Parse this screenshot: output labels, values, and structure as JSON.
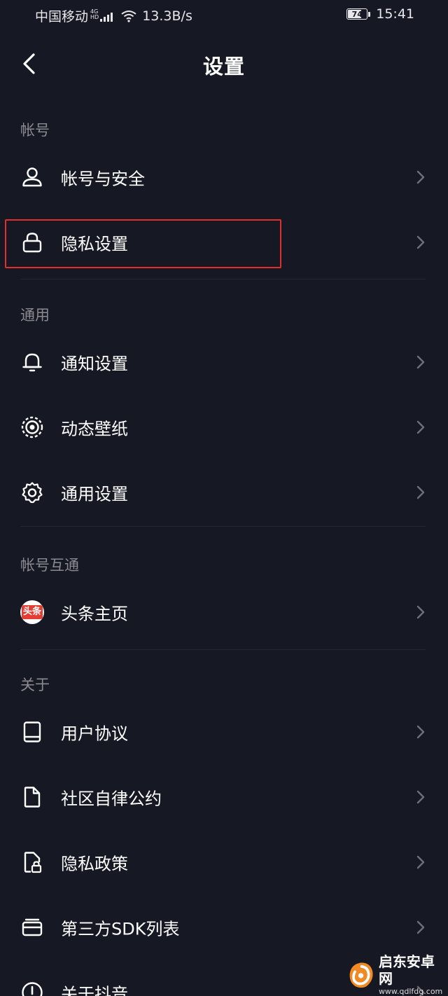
{
  "status_bar": {
    "carrier": "中国移动",
    "net_type_top": "4G",
    "net_type_bottom": "HD",
    "speed": "13.3B/s",
    "battery_level": "74",
    "battery_fraction": 0.74,
    "time": "15:41"
  },
  "nav": {
    "title": "设置"
  },
  "sections": [
    {
      "label": "帐号",
      "items": [
        {
          "label": "帐号与安全",
          "icon": "user-icon"
        },
        {
          "label": "隐私设置",
          "icon": "lock-icon",
          "highlighted": true
        }
      ]
    },
    {
      "label": "通用",
      "items": [
        {
          "label": "通知设置",
          "icon": "bell-icon"
        },
        {
          "label": "动态壁纸",
          "icon": "live-wallpaper-icon"
        },
        {
          "label": "通用设置",
          "icon": "gear-icon"
        }
      ]
    },
    {
      "label": "帐号互通",
      "items": [
        {
          "label": "头条主页",
          "icon": "toutiao-icon",
          "badge_text": "头条"
        }
      ]
    },
    {
      "label": "关于",
      "items": [
        {
          "label": "用户协议",
          "icon": "book-icon"
        },
        {
          "label": "社区自律公约",
          "icon": "document-icon"
        },
        {
          "label": "隐私政策",
          "icon": "privacy-doc-icon"
        },
        {
          "label": "第三方SDK列表",
          "icon": "card-stack-icon"
        },
        {
          "label": "关于抖音",
          "icon": "info-icon"
        }
      ]
    }
  ],
  "watermark": {
    "name": "启东安卓网",
    "url": "www.qdlfdq.com"
  },
  "colors": {
    "background": "#161823",
    "highlight": "#e0302e",
    "section_label": "#8a8b91"
  }
}
